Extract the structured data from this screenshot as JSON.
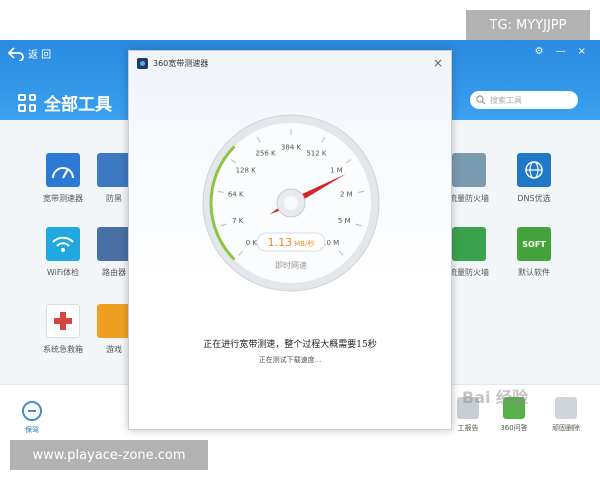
{
  "header": {
    "back_label": "返 回",
    "title": "全部工具",
    "search_placeholder": "搜索工具"
  },
  "tools": [
    {
      "label": "宽带测速器",
      "color": "#2b7ad8"
    },
    {
      "label": "防黑",
      "color": "#3e79c4"
    },
    {
      "label": "WiFi体检",
      "color": "#22a8e0"
    },
    {
      "label": "路由器",
      "color": "#4a6fa5"
    },
    {
      "label": "系统急救箱",
      "color": "#d4463f"
    },
    {
      "label": "游戏",
      "color": "#f0a020"
    },
    {
      "label": "流量防火墙",
      "color": "#7a9ab0"
    },
    {
      "label": "DNS优选",
      "color": "#1f78c8"
    },
    {
      "label": "流量防火墙",
      "color": "#3aa24c"
    },
    {
      "label": "默认软件",
      "color": "#45a33b"
    },
    {
      "label": "SOFT",
      "color": "#ffffff"
    }
  ],
  "bottom": {
    "home_label": "保驾",
    "tools": [
      {
        "label": "工报告",
        "color": "#c8ced6"
      },
      {
        "label": "360问答",
        "color": "#58b04a"
      },
      {
        "label": "顽固删除",
        "color": "#d0d5db"
      }
    ]
  },
  "dialog": {
    "title": "360宽带测速器",
    "close_symbol": "×",
    "gauge": {
      "tick_labels": [
        "0 K",
        "7 K",
        "64 K",
        "128 K",
        "256 K",
        "384 K",
        "512 K",
        "1 M",
        "2 M",
        "5 M",
        "10 M"
      ],
      "speed_value": "1.13",
      "speed_unit": "MB/秒",
      "caption": "即时网速",
      "needle_fraction": 0.73
    },
    "status_main": "正在进行宽带测速，整个过程大概需要15秒",
    "status_sub": "正在测试下载速度..."
  },
  "watermarks": {
    "tg": "TG: MYYJJPP",
    "site": "www.playace-zone.com",
    "baidu": "Bai 经验"
  },
  "colors": {
    "header_blue": "#2a8be0",
    "needle_red": "#d8222a",
    "speed_orange": "#f08c1e",
    "gauge_green": "#8cc63f"
  }
}
